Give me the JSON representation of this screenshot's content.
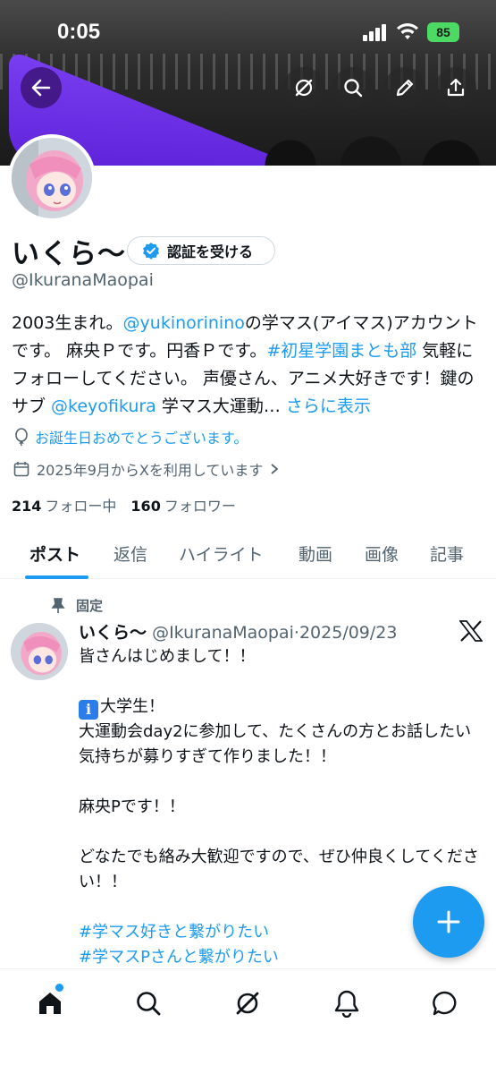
{
  "status_bar": {
    "time": "0:05",
    "battery": "85"
  },
  "profile": {
    "display_name": "いくら〜",
    "verify_button": "認証を受ける",
    "handle": "@IkuranaMaopai",
    "bio": {
      "part1": "2003生まれ。",
      "mention1": "@yukinorinino",
      "part2": "の学マス(アイマス)アカウントです。 麻央Ｐです。円香Ｐです。",
      "hashtag": "#初星学園まとも部",
      "part3": " 気軽にフォローしてください。 声優さん、アニメ大好きです！鍵のサブ ",
      "mention2": "@keyofikura",
      "part4": " 学マス大運動… ",
      "show_more": "さらに表示"
    },
    "birthday": "お誕生日おめでとうございます。",
    "joined": "2025年9月からXを利用しています",
    "following_count": "214",
    "following_label": "フォロー中",
    "followers_count": "160",
    "followers_label": "フォロワー"
  },
  "tabs": [
    "ポスト",
    "返信",
    "ハイライト",
    "動画",
    "画像",
    "記事"
  ],
  "post": {
    "pinned_label": "固定",
    "author_name": "いくら〜",
    "author_handle": "@IkuranaMaopai",
    "separator": "·",
    "date": "2025/09/23",
    "lines": [
      "皆さんはじめまして！！",
      "",
      "大学生！",
      "大運動会day2に参加して、たくさんの方とお話したい気持ちが募りすぎて作りました！！",
      "",
      "麻央Pです！！",
      "",
      "どなたでも絡み大歓迎ですので、ぜひ仲良くしてください！！",
      "",
      "#学マス好きと繋がりたい",
      "#学マスPさんと繋がりたい"
    ],
    "info_emoji": "i"
  },
  "icons": {
    "back": "arrow-left-icon",
    "grok": "grok-icon",
    "search": "search-icon",
    "edit": "pencil-icon",
    "share": "share-icon",
    "verified": "verified-badge-icon",
    "birthday": "balloon-icon",
    "calendar": "calendar-icon",
    "pin": "pin-icon",
    "x_logo": "x-logo-icon",
    "compose": "plus-icon",
    "nav": [
      "home-icon",
      "search-icon",
      "grok-icon",
      "bell-icon",
      "messages-icon"
    ]
  },
  "colors": {
    "accent": "#1d9bf0",
    "text": "#0f1419",
    "muted": "#536471",
    "battery": "#4cd964"
  }
}
